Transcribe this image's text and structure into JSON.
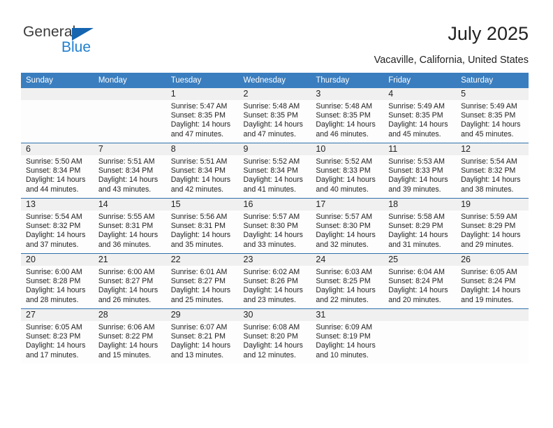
{
  "brand": {
    "name_top": "General",
    "name_bottom": "Blue",
    "triangle_color": "#1565b0",
    "blue_color": "#1f7fd0"
  },
  "header": {
    "title": "July 2025",
    "subtitle": "Vacaville, California, United States"
  },
  "theme": {
    "header_band": "#3a7ebf",
    "row_divider": "#2f6fae",
    "daynum_band": "#f0f0f0",
    "text": "#222222"
  },
  "calendar": {
    "weekday_headers": [
      "Sunday",
      "Monday",
      "Tuesday",
      "Wednesday",
      "Thursday",
      "Friday",
      "Saturday"
    ],
    "weeks": [
      [
        {
          "day": "",
          "sunrise": "",
          "sunset": "",
          "daylight_1": "",
          "daylight_2": ""
        },
        {
          "day": "",
          "sunrise": "",
          "sunset": "",
          "daylight_1": "",
          "daylight_2": ""
        },
        {
          "day": "1",
          "sunrise": "Sunrise: 5:47 AM",
          "sunset": "Sunset: 8:35 PM",
          "daylight_1": "Daylight: 14 hours",
          "daylight_2": "and 47 minutes."
        },
        {
          "day": "2",
          "sunrise": "Sunrise: 5:48 AM",
          "sunset": "Sunset: 8:35 PM",
          "daylight_1": "Daylight: 14 hours",
          "daylight_2": "and 47 minutes."
        },
        {
          "day": "3",
          "sunrise": "Sunrise: 5:48 AM",
          "sunset": "Sunset: 8:35 PM",
          "daylight_1": "Daylight: 14 hours",
          "daylight_2": "and 46 minutes."
        },
        {
          "day": "4",
          "sunrise": "Sunrise: 5:49 AM",
          "sunset": "Sunset: 8:35 PM",
          "daylight_1": "Daylight: 14 hours",
          "daylight_2": "and 45 minutes."
        },
        {
          "day": "5",
          "sunrise": "Sunrise: 5:49 AM",
          "sunset": "Sunset: 8:35 PM",
          "daylight_1": "Daylight: 14 hours",
          "daylight_2": "and 45 minutes."
        }
      ],
      [
        {
          "day": "6",
          "sunrise": "Sunrise: 5:50 AM",
          "sunset": "Sunset: 8:34 PM",
          "daylight_1": "Daylight: 14 hours",
          "daylight_2": "and 44 minutes."
        },
        {
          "day": "7",
          "sunrise": "Sunrise: 5:51 AM",
          "sunset": "Sunset: 8:34 PM",
          "daylight_1": "Daylight: 14 hours",
          "daylight_2": "and 43 minutes."
        },
        {
          "day": "8",
          "sunrise": "Sunrise: 5:51 AM",
          "sunset": "Sunset: 8:34 PM",
          "daylight_1": "Daylight: 14 hours",
          "daylight_2": "and 42 minutes."
        },
        {
          "day": "9",
          "sunrise": "Sunrise: 5:52 AM",
          "sunset": "Sunset: 8:34 PM",
          "daylight_1": "Daylight: 14 hours",
          "daylight_2": "and 41 minutes."
        },
        {
          "day": "10",
          "sunrise": "Sunrise: 5:52 AM",
          "sunset": "Sunset: 8:33 PM",
          "daylight_1": "Daylight: 14 hours",
          "daylight_2": "and 40 minutes."
        },
        {
          "day": "11",
          "sunrise": "Sunrise: 5:53 AM",
          "sunset": "Sunset: 8:33 PM",
          "daylight_1": "Daylight: 14 hours",
          "daylight_2": "and 39 minutes."
        },
        {
          "day": "12",
          "sunrise": "Sunrise: 5:54 AM",
          "sunset": "Sunset: 8:32 PM",
          "daylight_1": "Daylight: 14 hours",
          "daylight_2": "and 38 minutes."
        }
      ],
      [
        {
          "day": "13",
          "sunrise": "Sunrise: 5:54 AM",
          "sunset": "Sunset: 8:32 PM",
          "daylight_1": "Daylight: 14 hours",
          "daylight_2": "and 37 minutes."
        },
        {
          "day": "14",
          "sunrise": "Sunrise: 5:55 AM",
          "sunset": "Sunset: 8:31 PM",
          "daylight_1": "Daylight: 14 hours",
          "daylight_2": "and 36 minutes."
        },
        {
          "day": "15",
          "sunrise": "Sunrise: 5:56 AM",
          "sunset": "Sunset: 8:31 PM",
          "daylight_1": "Daylight: 14 hours",
          "daylight_2": "and 35 minutes."
        },
        {
          "day": "16",
          "sunrise": "Sunrise: 5:57 AM",
          "sunset": "Sunset: 8:30 PM",
          "daylight_1": "Daylight: 14 hours",
          "daylight_2": "and 33 minutes."
        },
        {
          "day": "17",
          "sunrise": "Sunrise: 5:57 AM",
          "sunset": "Sunset: 8:30 PM",
          "daylight_1": "Daylight: 14 hours",
          "daylight_2": "and 32 minutes."
        },
        {
          "day": "18",
          "sunrise": "Sunrise: 5:58 AM",
          "sunset": "Sunset: 8:29 PM",
          "daylight_1": "Daylight: 14 hours",
          "daylight_2": "and 31 minutes."
        },
        {
          "day": "19",
          "sunrise": "Sunrise: 5:59 AM",
          "sunset": "Sunset: 8:29 PM",
          "daylight_1": "Daylight: 14 hours",
          "daylight_2": "and 29 minutes."
        }
      ],
      [
        {
          "day": "20",
          "sunrise": "Sunrise: 6:00 AM",
          "sunset": "Sunset: 8:28 PM",
          "daylight_1": "Daylight: 14 hours",
          "daylight_2": "and 28 minutes."
        },
        {
          "day": "21",
          "sunrise": "Sunrise: 6:00 AM",
          "sunset": "Sunset: 8:27 PM",
          "daylight_1": "Daylight: 14 hours",
          "daylight_2": "and 26 minutes."
        },
        {
          "day": "22",
          "sunrise": "Sunrise: 6:01 AM",
          "sunset": "Sunset: 8:27 PM",
          "daylight_1": "Daylight: 14 hours",
          "daylight_2": "and 25 minutes."
        },
        {
          "day": "23",
          "sunrise": "Sunrise: 6:02 AM",
          "sunset": "Sunset: 8:26 PM",
          "daylight_1": "Daylight: 14 hours",
          "daylight_2": "and 23 minutes."
        },
        {
          "day": "24",
          "sunrise": "Sunrise: 6:03 AM",
          "sunset": "Sunset: 8:25 PM",
          "daylight_1": "Daylight: 14 hours",
          "daylight_2": "and 22 minutes."
        },
        {
          "day": "25",
          "sunrise": "Sunrise: 6:04 AM",
          "sunset": "Sunset: 8:24 PM",
          "daylight_1": "Daylight: 14 hours",
          "daylight_2": "and 20 minutes."
        },
        {
          "day": "26",
          "sunrise": "Sunrise: 6:05 AM",
          "sunset": "Sunset: 8:24 PM",
          "daylight_1": "Daylight: 14 hours",
          "daylight_2": "and 19 minutes."
        }
      ],
      [
        {
          "day": "27",
          "sunrise": "Sunrise: 6:05 AM",
          "sunset": "Sunset: 8:23 PM",
          "daylight_1": "Daylight: 14 hours",
          "daylight_2": "and 17 minutes."
        },
        {
          "day": "28",
          "sunrise": "Sunrise: 6:06 AM",
          "sunset": "Sunset: 8:22 PM",
          "daylight_1": "Daylight: 14 hours",
          "daylight_2": "and 15 minutes."
        },
        {
          "day": "29",
          "sunrise": "Sunrise: 6:07 AM",
          "sunset": "Sunset: 8:21 PM",
          "daylight_1": "Daylight: 14 hours",
          "daylight_2": "and 13 minutes."
        },
        {
          "day": "30",
          "sunrise": "Sunrise: 6:08 AM",
          "sunset": "Sunset: 8:20 PM",
          "daylight_1": "Daylight: 14 hours",
          "daylight_2": "and 12 minutes."
        },
        {
          "day": "31",
          "sunrise": "Sunrise: 6:09 AM",
          "sunset": "Sunset: 8:19 PM",
          "daylight_1": "Daylight: 14 hours",
          "daylight_2": "and 10 minutes."
        },
        {
          "day": "",
          "sunrise": "",
          "sunset": "",
          "daylight_1": "",
          "daylight_2": ""
        },
        {
          "day": "",
          "sunrise": "",
          "sunset": "",
          "daylight_1": "",
          "daylight_2": ""
        }
      ]
    ]
  }
}
